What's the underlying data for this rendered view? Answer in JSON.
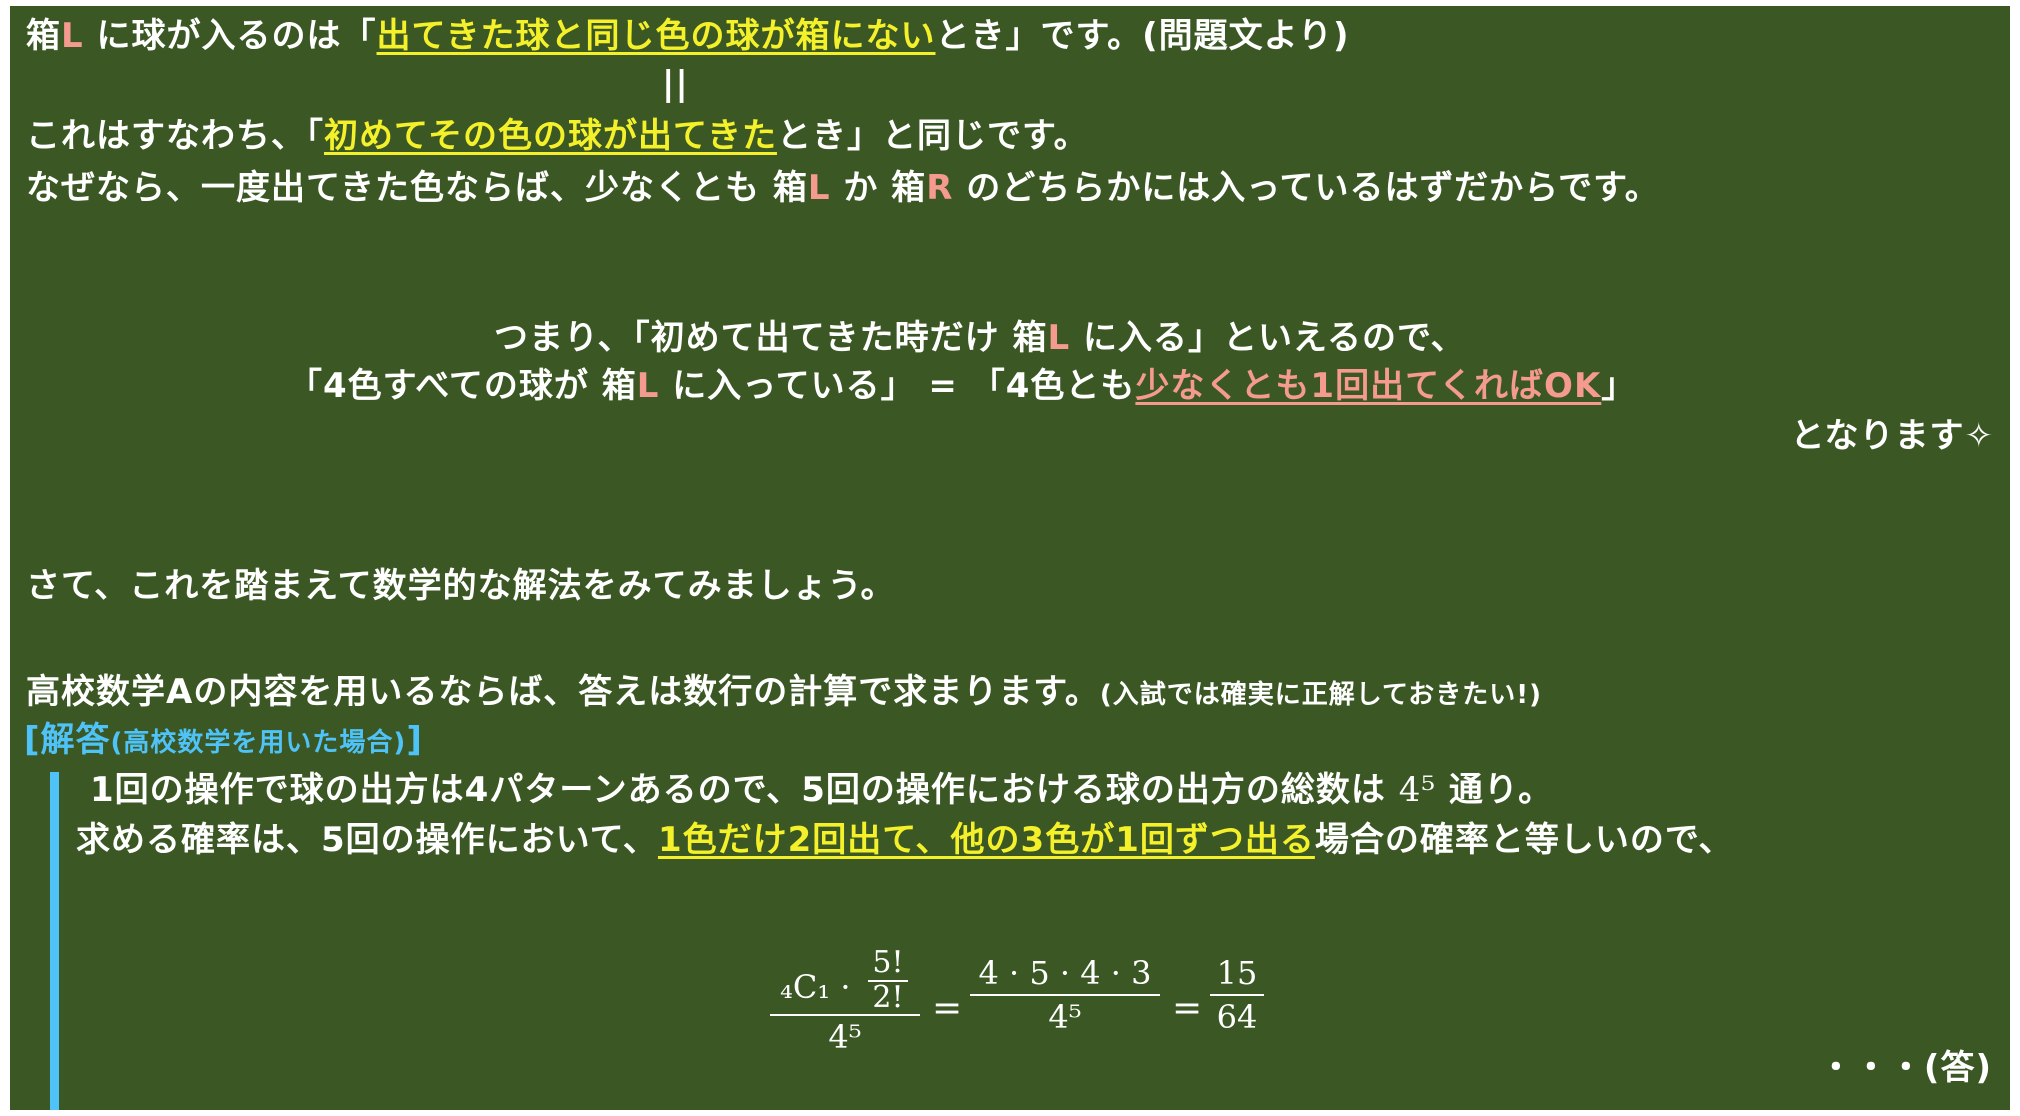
{
  "l1": {
    "a": "箱",
    "b": "L",
    "c": " に球が入るのは「",
    "d": "出てきた球と同じ色の球が箱にない",
    "e": "とき」です。(問題文より)"
  },
  "l2": "||",
  "l3": {
    "a": "これはすなわち、「",
    "b": "初めてその色の球が出てきた",
    "c": "とき」と同じです。"
  },
  "l4": {
    "a": "なぜなら、一度出てきた色ならば、少なくとも 箱",
    "b": "L",
    "c": " か 箱",
    "d": "R",
    "e": " のどちらかには入っているはずだからです。"
  },
  "l5": {
    "a": "つまり、「初めて出てきた時だけ 箱",
    "b": "L",
    "c": " に入る」といえるので、"
  },
  "l6": {
    "a": "「4色すべての球が 箱",
    "b": "L",
    "c": " に入っている」 = 「4色とも",
    "d": "少なくとも1回出てくればOK",
    "e": "」"
  },
  "l7": "となります✧",
  "l8": "さて、これを踏まえて数学的な解法をみてみましょう。",
  "l9": {
    "a": "高校数学Aの内容を用いるならば、答えは数行の計算で求まります。",
    "b": "(入試では確実に正解しておきたい!)"
  },
  "l10": {
    "a": "[解答",
    "b": "(高校数学を用いた場合)",
    "c": "]"
  },
  "l11": {
    "a": "1回の操作で球の出方は4パターンあるので、5回の操作における球の出方の総数は ",
    "b": "4⁵",
    "c": " 通り。"
  },
  "l12": {
    "a": "求める確率は、5回の操作において、",
    "b": "1色だけ2回出て、他の3色が1回ずつ出る",
    "c": "場合の確率と等しいので、"
  },
  "formula": {
    "f1_num_a": "₄C₁ ·",
    "f1_inner_num": "5!",
    "f1_inner_den": "2!",
    "f1_den": "4⁵",
    "eq1": "=",
    "f2_num": "4 · 5 · 4 · 3",
    "f2_den": "4⁵",
    "eq2": "=",
    "f3_num": "15",
    "f3_den": "64"
  },
  "answer": "・・・(答)",
  "colors": {
    "board": "#3a5724",
    "pink": "#f59a8e",
    "yellow": "#f4f02a",
    "blue": "#4fc3f7"
  }
}
